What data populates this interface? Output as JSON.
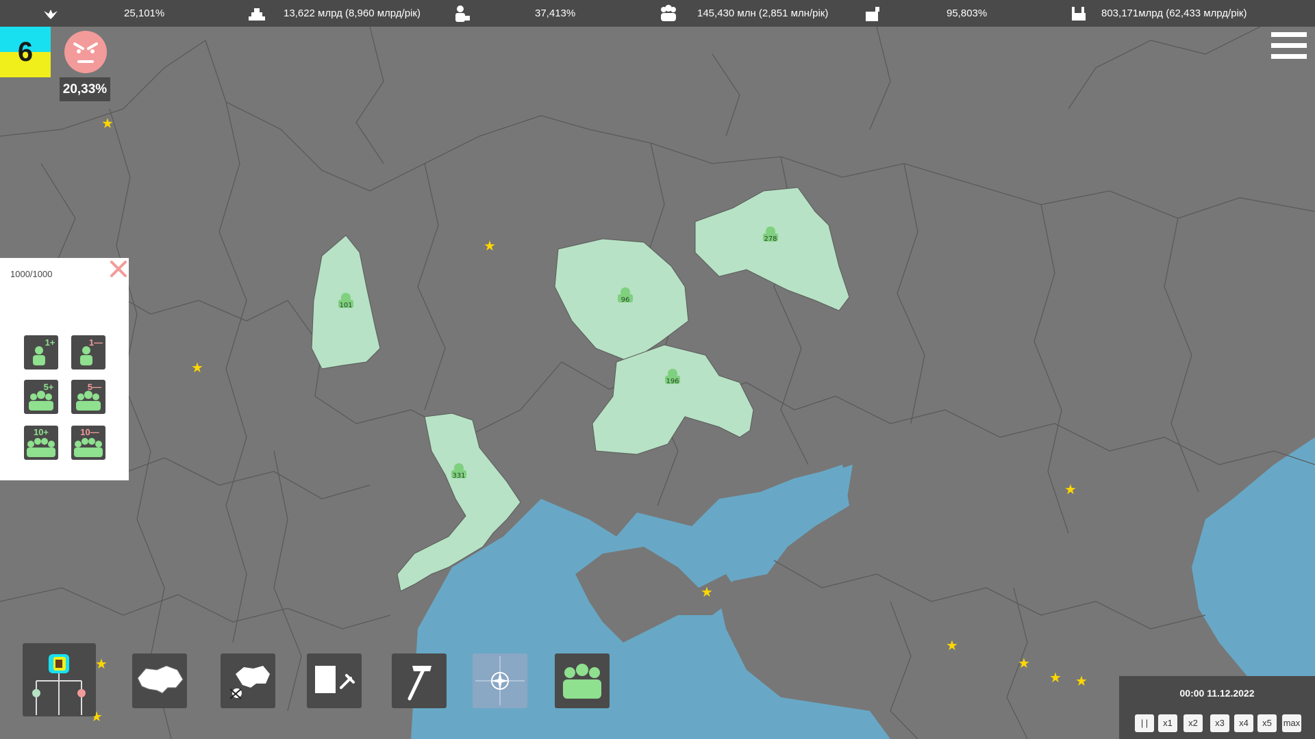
{
  "top_stats": [
    {
      "icon": "dove-icon",
      "value": "25,101%"
    },
    {
      "icon": "gold-bars-icon",
      "value": "13,622 млрд (8,960 млрд/рік)"
    },
    {
      "icon": "worker-icon",
      "value": "37,413%"
    },
    {
      "icon": "population-icon",
      "value": "145,430 млн (2,851 млн/рік)"
    },
    {
      "icon": "briefcase-icon",
      "value": "95,803%"
    },
    {
      "icon": "factory-icon",
      "value": "803,171млрд (62,433 млрд/рік)"
    }
  ],
  "player": {
    "level": "6",
    "mood_value": "20,33%",
    "flag_colors": [
      "#19e0f0",
      "#f0ef1b"
    ]
  },
  "troop_panel": {
    "count": "1000/1000",
    "buttons": [
      {
        "label": "1+",
        "kind": "add"
      },
      {
        "label": "1—",
        "kind": "remove"
      },
      {
        "label": "5+",
        "kind": "add"
      },
      {
        "label": "5—",
        "kind": "remove"
      },
      {
        "label": "10+",
        "kind": "add"
      },
      {
        "label": "10—",
        "kind": "remove"
      }
    ]
  },
  "map": {
    "colors": {
      "land": "#777777",
      "sea": "#68a8c6",
      "owned": "#b7e2c5",
      "border": "#5a5a5a",
      "capital_star": "#ffd700"
    },
    "unit_labels": [
      "101",
      "96",
      "278",
      "196",
      "331"
    ]
  },
  "toolbar": {
    "tools": [
      {
        "icon": "alliance-tree-icon"
      },
      {
        "icon": "ukraine-regions-map-icon"
      },
      {
        "icon": "war-map-icon"
      },
      {
        "icon": "documents-law-icon"
      },
      {
        "icon": "hammer-icon"
      },
      {
        "icon": "nato-compass-icon"
      },
      {
        "icon": "soldiers-group-icon"
      }
    ]
  },
  "time": {
    "display": "00:00 11.12.2022",
    "speeds": [
      "| |",
      "x1",
      "x2",
      "x3",
      "x4",
      "x5",
      "max"
    ]
  }
}
